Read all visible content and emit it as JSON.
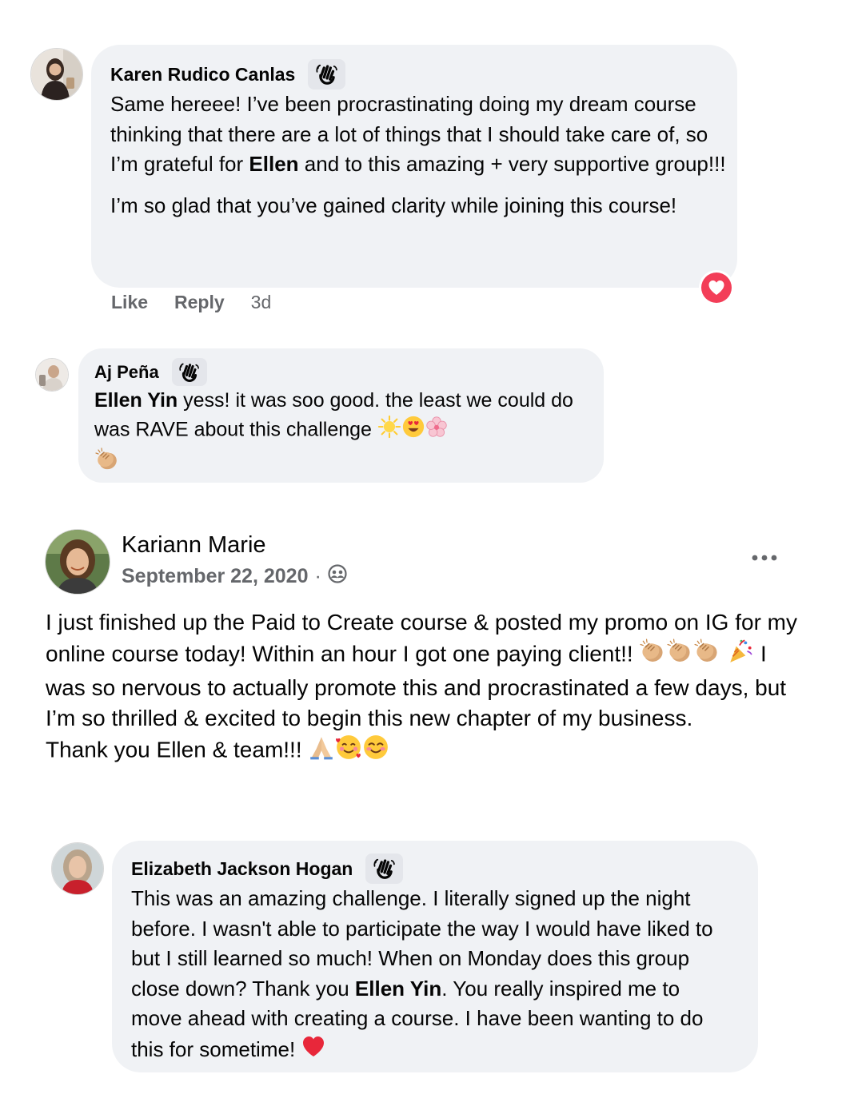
{
  "comment1": {
    "author": "Karen Rudico Canlas",
    "paragraph1_a": "Same hereee! I’ve been procrastinating doing my dream course thinking that there are a lot of things that I should take care of, so I’m grateful for ",
    "paragraph1_mention": "Ellen",
    "paragraph1_b": " and to this amazing + very supportive group!!!",
    "paragraph2": "I’m so glad that you’ve gained clarity while joining this course!",
    "like_label": "Like",
    "reply_label": "Reply",
    "timestamp": "3d",
    "reaction_icon": "heart-reaction-icon"
  },
  "comment2": {
    "author": "Aj Peña",
    "mention": "Ellen Yin",
    "text": " yess! it was soo good. the least we could do was RAVE about this challenge"
  },
  "post": {
    "author": "Kariann Marie",
    "date": "September 22, 2020",
    "separator": "·",
    "audience_icon": "group-audience-icon",
    "more_icon": "more-options-icon",
    "line1": "I just finished up the Paid to Create course & posted my promo on IG for my online course today!  Within an hour I got one paying client!!",
    "line2": "I was so nervous to actually promote this and procrastinated a few days, but I’m so thrilled & excited to begin this new chapter of my business.",
    "line3": "Thank you Ellen & team!!!"
  },
  "comment3": {
    "author": "Elizabeth Jackson Hogan",
    "text_a": "This was an amazing challenge. I literally signed up the night before. I wasn't able to participate the way I would have liked to but I still learned so much! When on Monday does this group close down? Thank you ",
    "mention": "Ellen Yin",
    "text_b": ". You really inspired me to move ahead with creating a course. I have been wanting to do this for sometime!"
  },
  "colors": {
    "bubble": "#f0f2f5",
    "secondary_text": "#65676b",
    "heart": "#f33e58"
  }
}
